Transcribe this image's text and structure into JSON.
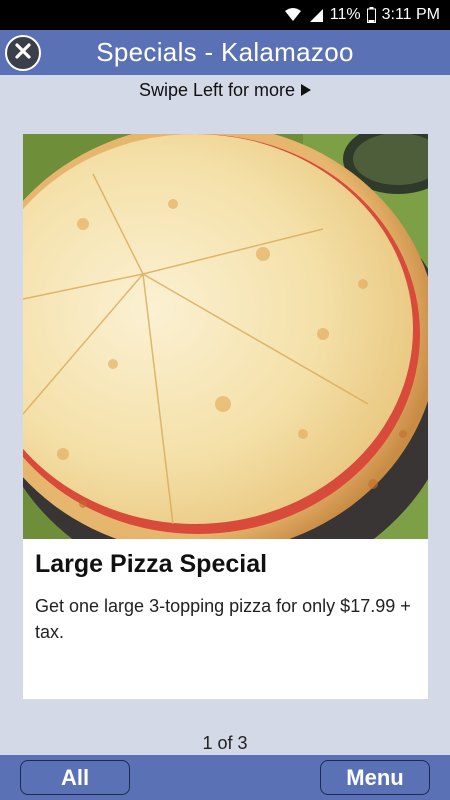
{
  "status_bar": {
    "battery_percent": "11%",
    "time": "3:11 PM",
    "icons": [
      "wifi-icon",
      "signal-icon",
      "battery-icon"
    ]
  },
  "header": {
    "title": "Specials - Kalamazoo",
    "close_icon": "close-icon"
  },
  "swipe_hint": {
    "text": "Swipe Left for more",
    "icon": "play-arrow-icon"
  },
  "special": {
    "image": "pizza-photo",
    "title": "Large Pizza Special",
    "description": "Get one large 3-topping pizza for only $17.99 + tax."
  },
  "pager": {
    "text": "1 of 3"
  },
  "bottom_bar": {
    "all_label": "All",
    "menu_label": "Menu"
  },
  "colors": {
    "header_bg": "#5a72b5",
    "page_bg": "#d4d9e7",
    "status_bar_bg": "#000000"
  }
}
